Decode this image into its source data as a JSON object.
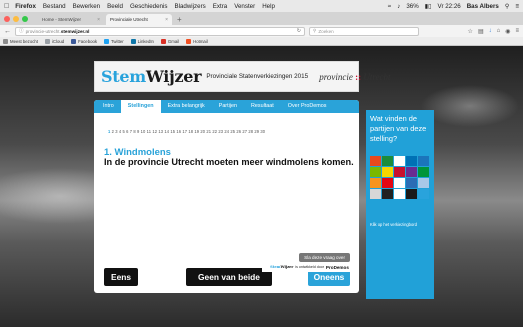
{
  "menubar": {
    "items": [
      "Firefox",
      "Bestand",
      "Bewerken",
      "Beeld",
      "Geschiedenis",
      "Bladwijzers",
      "Extra",
      "Venster",
      "Help"
    ],
    "battery": "36%",
    "clock": "Vr 22:26",
    "user": "Bas Albers"
  },
  "tabs": [
    {
      "label": "Home - StemWijzer"
    },
    {
      "label": "Provinciale Utrecht"
    }
  ],
  "navbar": {
    "url_prefix": "provincie-utrecht.",
    "url_domain": "stemwijzer.nl",
    "search_placeholder": "Zoeken"
  },
  "bookmarks": [
    {
      "label": "Meest bezocht",
      "color": "#8c8c8c"
    },
    {
      "label": "iCloud",
      "color": "#9aa0a6"
    },
    {
      "label": "Facebook",
      "color": "#3b5998"
    },
    {
      "label": "Twitter",
      "color": "#1da1f2"
    },
    {
      "label": "LinkedIn",
      "color": "#0e76a8"
    },
    {
      "label": "Gmail",
      "color": "#d93025"
    },
    {
      "label": "Hotmail",
      "color": "#f25022"
    }
  ],
  "header": {
    "logo_stem": "Stem",
    "logo_wijzer": "Wijzer",
    "election": "Provinciale Statenverkiezingen 2015",
    "province_a": "provincie",
    "province_sep": "::",
    "province_b": "Utrecht"
  },
  "nav": {
    "tabs": [
      "Intro",
      "Stellingen",
      "Extra belangrijk",
      "Partijen",
      "Resultaat",
      "Over ProDemos"
    ],
    "active_index": 1
  },
  "question": {
    "page_numbers": [
      "1",
      "2",
      "3",
      "4",
      "5",
      "6",
      "7",
      "8",
      "9",
      "10",
      "11",
      "12",
      "13",
      "14",
      "15",
      "16",
      "17",
      "18",
      "19",
      "20",
      "21",
      "22",
      "23",
      "24",
      "25",
      "26",
      "27",
      "28",
      "29",
      "30"
    ],
    "current_page": "1",
    "title": "1. Windmolens",
    "text": "In de provincie Utrecht moeten meer windmolens komen.",
    "skip_label": "Sla deze vraag over"
  },
  "answers": {
    "agree": "Eens",
    "neutral": "Geen van beide",
    "disagree": "Oneens"
  },
  "side": {
    "question": "Wat vinden de partijen van deze stelling?",
    "link": "Klik op het verkiezingbord",
    "tile_colors": [
      "#e8491d",
      "#1c8c3c",
      "#ffffff",
      "#0071b5",
      "#1b75bb",
      "#7ab800",
      "#f6d600",
      "#c8102e",
      "#6a2c91",
      "#00953a",
      "#f7941d",
      "#e30613",
      "#ffffff",
      "#2b6db5",
      "#a8c8e8",
      "#d7d7d7",
      "#222222",
      "#ffffff",
      "#1a1a1a",
      "#29a3dc"
    ]
  },
  "footer": {
    "made_by": "is ontwikkeld door",
    "logo_stem": "Stem",
    "logo_wijzer": "Wijzer",
    "org": "ProDemos"
  }
}
